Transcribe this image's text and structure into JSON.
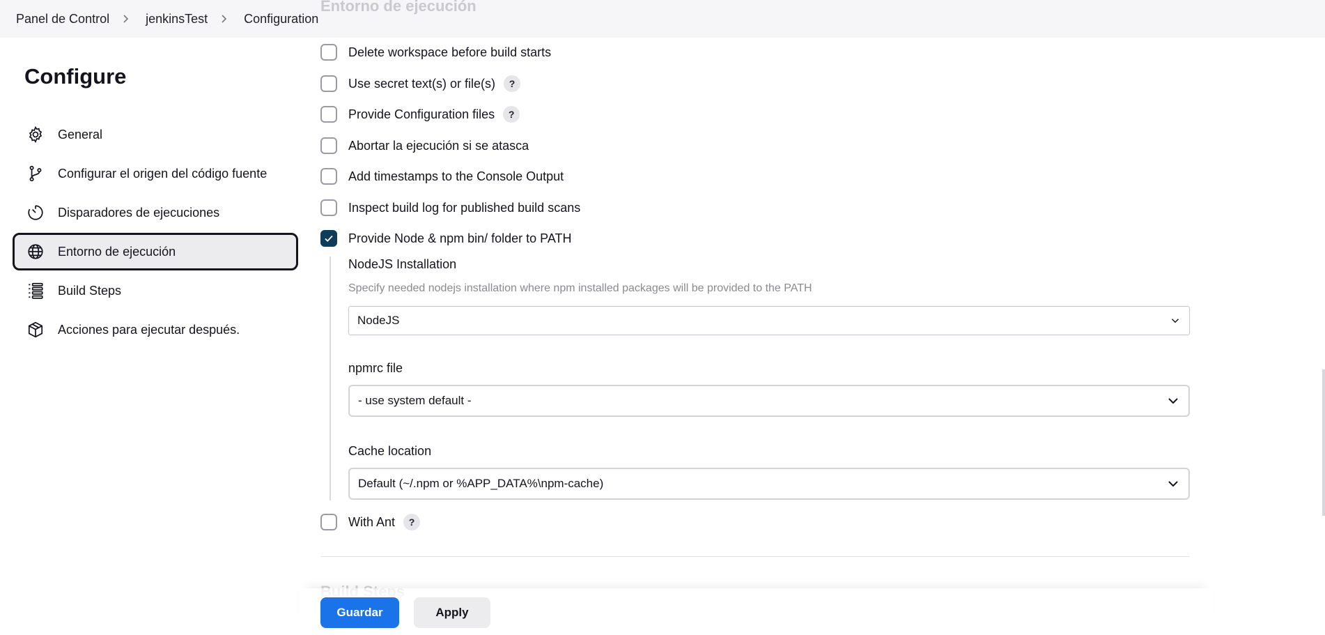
{
  "breadcrumb": {
    "items": [
      "Panel de Control",
      "jenkinsTest",
      "Configuration"
    ]
  },
  "section_title_faded": "Entorno de ejecución",
  "sidebar": {
    "title": "Configure",
    "items": [
      {
        "label": "General",
        "icon": "gear-icon"
      },
      {
        "label": "Configurar el origen del código fuente",
        "icon": "git-branch-icon"
      },
      {
        "label": "Disparadores de ejecuciones",
        "icon": "timer-icon"
      },
      {
        "label": "Entorno de ejecución",
        "icon": "globe-icon",
        "active": true
      },
      {
        "label": "Build Steps",
        "icon": "list-icon"
      },
      {
        "label": "Acciones para ejecutar después.",
        "icon": "package-icon"
      }
    ]
  },
  "options": [
    {
      "label": "Delete workspace before build starts",
      "checked": false,
      "help": false
    },
    {
      "label": "Use secret text(s) or file(s)",
      "checked": false,
      "help": true
    },
    {
      "label": "Provide Configuration files",
      "checked": false,
      "help": true
    },
    {
      "label": "Abortar la ejecución si se atasca",
      "checked": false,
      "help": false
    },
    {
      "label": "Add timestamps to the Console Output",
      "checked": false,
      "help": false
    },
    {
      "label": "Inspect build log for published build scans",
      "checked": false,
      "help": false
    },
    {
      "label": "Provide Node & npm bin/ folder to PATH",
      "checked": true,
      "help": false
    }
  ],
  "help_glyph": "?",
  "node": {
    "installation_label": "NodeJS Installation",
    "installation_desc": "Specify needed nodejs installation where npm installed packages will be provided to the PATH",
    "installation_value": "NodeJS",
    "npmrc_label": "npmrc file",
    "npmrc_value": "- use system default -",
    "cache_label": "Cache location",
    "cache_value": "Default (~/.npm or %APP_DATA%\\npm-cache)"
  },
  "with_ant": {
    "label": "With Ant",
    "checked": false,
    "help": true
  },
  "next_section_title": "Build Steps",
  "actions": {
    "save": "Guardar",
    "apply": "Apply"
  },
  "colors": {
    "primary": "#1a73e8",
    "checkbox_checked": "#0e3c5a"
  }
}
